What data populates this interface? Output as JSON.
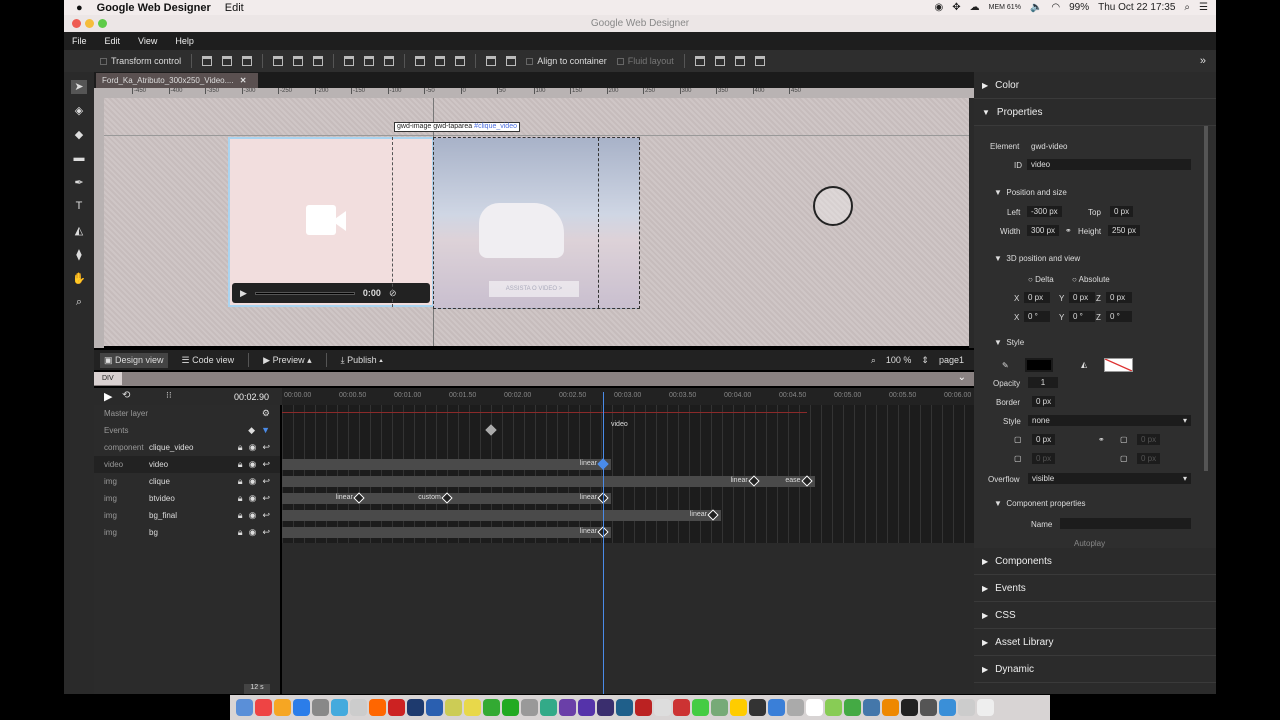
{
  "mac_menu": {
    "app": "Google Web Designer",
    "edit": "Edit",
    "mem": "MEM 61%",
    "battery": "99%",
    "clock": "Thu Oct 22  17:35"
  },
  "window_title": "Google Web Designer",
  "menu": [
    "File",
    "Edit",
    "View",
    "Help"
  ],
  "toolbar": {
    "transform_control": "Transform control",
    "align_to_container": "Align to container",
    "fluid_layout": "Fluid layout"
  },
  "doc_tab": "Ford_Ka_Atributo_300x250_Video....",
  "ruler_labels": [
    "-450",
    "-400",
    "-350",
    "-300",
    "-250",
    "-200",
    "-150",
    "-100",
    "-50",
    "0",
    "50",
    "100",
    "150",
    "200",
    "250",
    "300",
    "350",
    "400",
    "450"
  ],
  "stage": {
    "selection_label_1": "gwd-image",
    "selection_label_2": "gwd-taparea",
    "selection_label_3": "#clique_video",
    "video_time": "0:00",
    "cta": "ASSISTA O VIDEO  >"
  },
  "bottom_bar": {
    "design_view": "Design view",
    "code_view": "Code view",
    "preview": "Preview",
    "publish": "Publish",
    "zoom": "100 %",
    "page": "page1"
  },
  "breadcrumb": "DIV",
  "timeline": {
    "current_time": "00:02.90",
    "playhead_seconds": 2.9,
    "time_labels": [
      "00:00.00",
      "00:00.50",
      "00:01.00",
      "00:01.50",
      "00:02.00",
      "00:02.50",
      "00:03.00",
      "00:03.50",
      "00:04.00",
      "00:04.50",
      "00:05.00",
      "00:05.50",
      "00:06.00"
    ],
    "master_layer": "Master layer",
    "events": "Events",
    "event_label": "video",
    "event_marker_seconds": 1.88,
    "layers": [
      {
        "type": "component",
        "name": "clique_video",
        "keyframes": []
      },
      {
        "type": "video",
        "name": "video",
        "keyframes": [
          {
            "t": 2.9,
            "label": "linear",
            "selected": true
          }
        ]
      },
      {
        "type": "img",
        "name": "clique",
        "keyframes": [
          {
            "t": 4.27,
            "label": "linear"
          },
          {
            "t": 4.75,
            "label": "ease"
          }
        ]
      },
      {
        "type": "img",
        "name": "btvideo",
        "keyframes": [
          {
            "t": 0.68,
            "label": "linear"
          },
          {
            "t": 1.48,
            "label": "custom"
          },
          {
            "t": 2.9,
            "label": "linear"
          }
        ]
      },
      {
        "type": "img",
        "name": "bg_final",
        "keyframes": [
          {
            "t": 3.9,
            "label": "linear"
          }
        ]
      },
      {
        "type": "img",
        "name": "bg",
        "keyframes": [
          {
            "t": 2.9,
            "label": "linear"
          }
        ]
      }
    ],
    "duration": "12 s"
  },
  "panel": {
    "color": "Color",
    "properties": "Properties",
    "element_label": "Element",
    "element": "gwd-video",
    "id_label": "ID",
    "id": "video",
    "pos_size": "Position and size",
    "left_label": "Left",
    "left": "-300 px",
    "top_label": "Top",
    "top": "0 px",
    "width_label": "Width",
    "width": "300 px",
    "height_label": "Height",
    "height": "250 px",
    "threed": "3D position and view",
    "delta": "Delta",
    "absolute": "Absolute",
    "x": "X",
    "y": "Y",
    "z": "Z",
    "px0": "0 px",
    "deg0": "0 °",
    "style": "Style",
    "opacity_label": "Opacity",
    "opacity": "1",
    "border_label": "Border",
    "border": "0 px",
    "style_label": "Style",
    "style_value": "none",
    "radius": "0 px",
    "overflow_label": "Overflow",
    "overflow": "visible",
    "component_props": "Component properties",
    "name_label": "Name",
    "autoplay": "Autoplay",
    "sections": [
      "Components",
      "Events",
      "CSS",
      "Asset Library",
      "Dynamic"
    ]
  }
}
